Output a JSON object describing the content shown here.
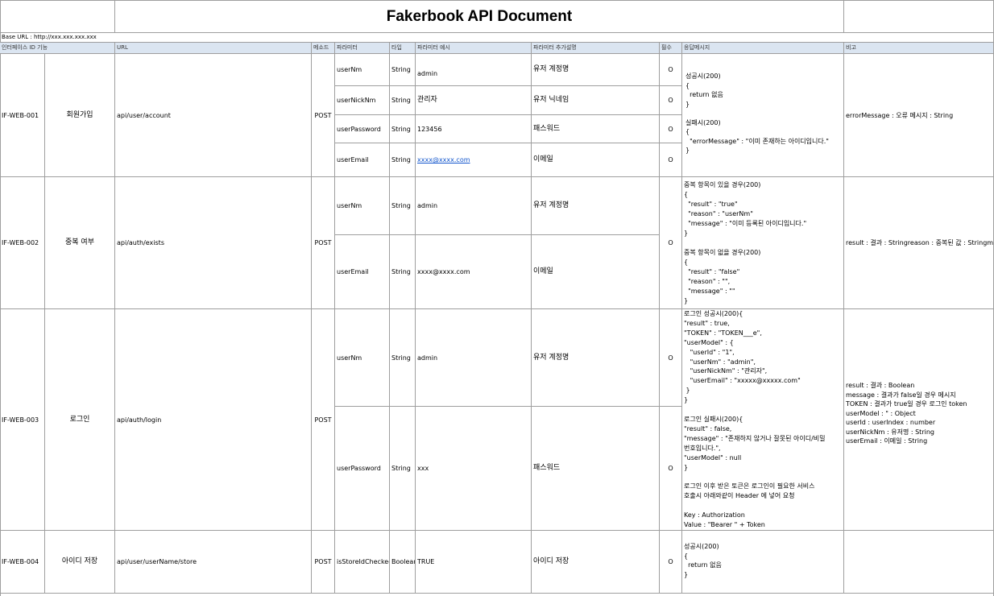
{
  "title": "Fakerbook API Document",
  "base_url": "Base URL : http://xxx.xxx.xxx.xxx",
  "headers": {
    "id": "인터페이스 ID",
    "func": "기능",
    "url": "URL",
    "method": "메소드",
    "param": "파라미터",
    "type": "타입",
    "example": "파라미터 예시",
    "desc": "파라미터 추가설명",
    "required": "필수",
    "response": "응답메시지",
    "note": "비고"
  },
  "rows": [
    {
      "id": "IF-WEB-001",
      "func": "회원가입",
      "url": "api/user/account",
      "method": "POST",
      "params": [
        {
          "name": "userNm",
          "type": "String",
          "example": "admin",
          "desc": "유저 계정명",
          "required": "O"
        },
        {
          "name": "userNickNm",
          "type": "String",
          "example": "관리자",
          "desc": "유저 닉네임",
          "required": "O"
        },
        {
          "name": "userPassword",
          "type": "String",
          "example": "123456",
          "desc": "패스워드",
          "required": "O"
        },
        {
          "name": "userEmail",
          "type": "String",
          "example": "xxxx@xxxx.com",
          "desc": "이메일",
          "required": "O"
        }
      ],
      "response": "성공시(200)\n{\n  return 없음\n}\n\n실패시(200)\n{\n  \"errorMessage\" : \"이미 존재하는 아이디입니다.\"\n}",
      "note": "errorMessage : 오류 메시지 : String"
    },
    {
      "id": "IF-WEB-002",
      "func": "중복 여부",
      "url": "api/auth/exists",
      "method": "POST",
      "params": [
        {
          "name": "userNm",
          "type": "String",
          "example": "admin",
          "desc": "유저 계정명"
        },
        {
          "name": "userEmail",
          "type": "String",
          "example": "xxxx@xxxx.com",
          "desc": "이메일"
        }
      ],
      "required": "O",
      "response": "중복 항목이 있을 경우(200)\n{\n  \"result\" : \"true\"\n  \"reason\" : \"userNm\"\n  \"message\" : \"이미 등록된 아이디입니다.\"\n}\n\n중복 항목이 없을 경우(200)\n{\n  \"result\" : \"false\"\n  \"reason\" : \"\",\n  \"message\" : \"\"\n}",
      "note": "result : 결과 : Stringreason : 중복된 값 : Stringme"
    },
    {
      "id": "IF-WEB-003",
      "func": "로그인",
      "url": "api/auth/login",
      "method": "POST",
      "params": [
        {
          "name": "userNm",
          "type": "String",
          "example": "admin",
          "desc": "유저 계정명",
          "required": "O"
        },
        {
          "name": "userPassword",
          "type": "String",
          "example": "xxx",
          "desc": "패스워드",
          "required": "O"
        }
      ],
      "response": "로그인 성공시(200){\n\"result\" : true,\n\"TOKEN\" : \"TOKEN___e\",\n\"userModel\" : {\n   \"userId\" : \"1\",\n   \"userNm\" : \"admin\",\n   \"userNickNm\" : \"관리자\",\n   \"userEmail\" : \"xxxxx@xxxxx.com\"\n }\n}\n\n로그인 실패시(200){\n\"result\" : false,\n\"message\" : \"존재하지 않거나 잘못된 아이디/비밀\n번호입니다.\",\n\"userModel\" : null\n}\n\n로그인 이후 받은 토큰은 로그인이 필요한 서비스\n호출시 아래와같이 Header 에 넣어 요청\n\nKey : Authorization\nValue : \"Bearer \" + Token",
      "note": "result : 결과 : Boolean\nmessage : 결과가 false일 경우 메시지\nTOKEN : 결과가 true일 경우 로그인 token\nuserModel : \" : Object\nuserId : userIndex : number\nuserNickNm : 유저명 : String\nuserEmail : 이메일 : String"
    },
    {
      "id": "IF-WEB-004",
      "func": "아이디 저장",
      "url": "api/user/userName/store",
      "method": "POST",
      "params": [
        {
          "name": "isStoreIdChecked",
          "type": "Boolean",
          "example": "TRUE",
          "desc": "아이디 저장",
          "required": "O"
        }
      ],
      "response": "성공시(200)\n{\n  return 없음\n}",
      "note": ""
    }
  ]
}
